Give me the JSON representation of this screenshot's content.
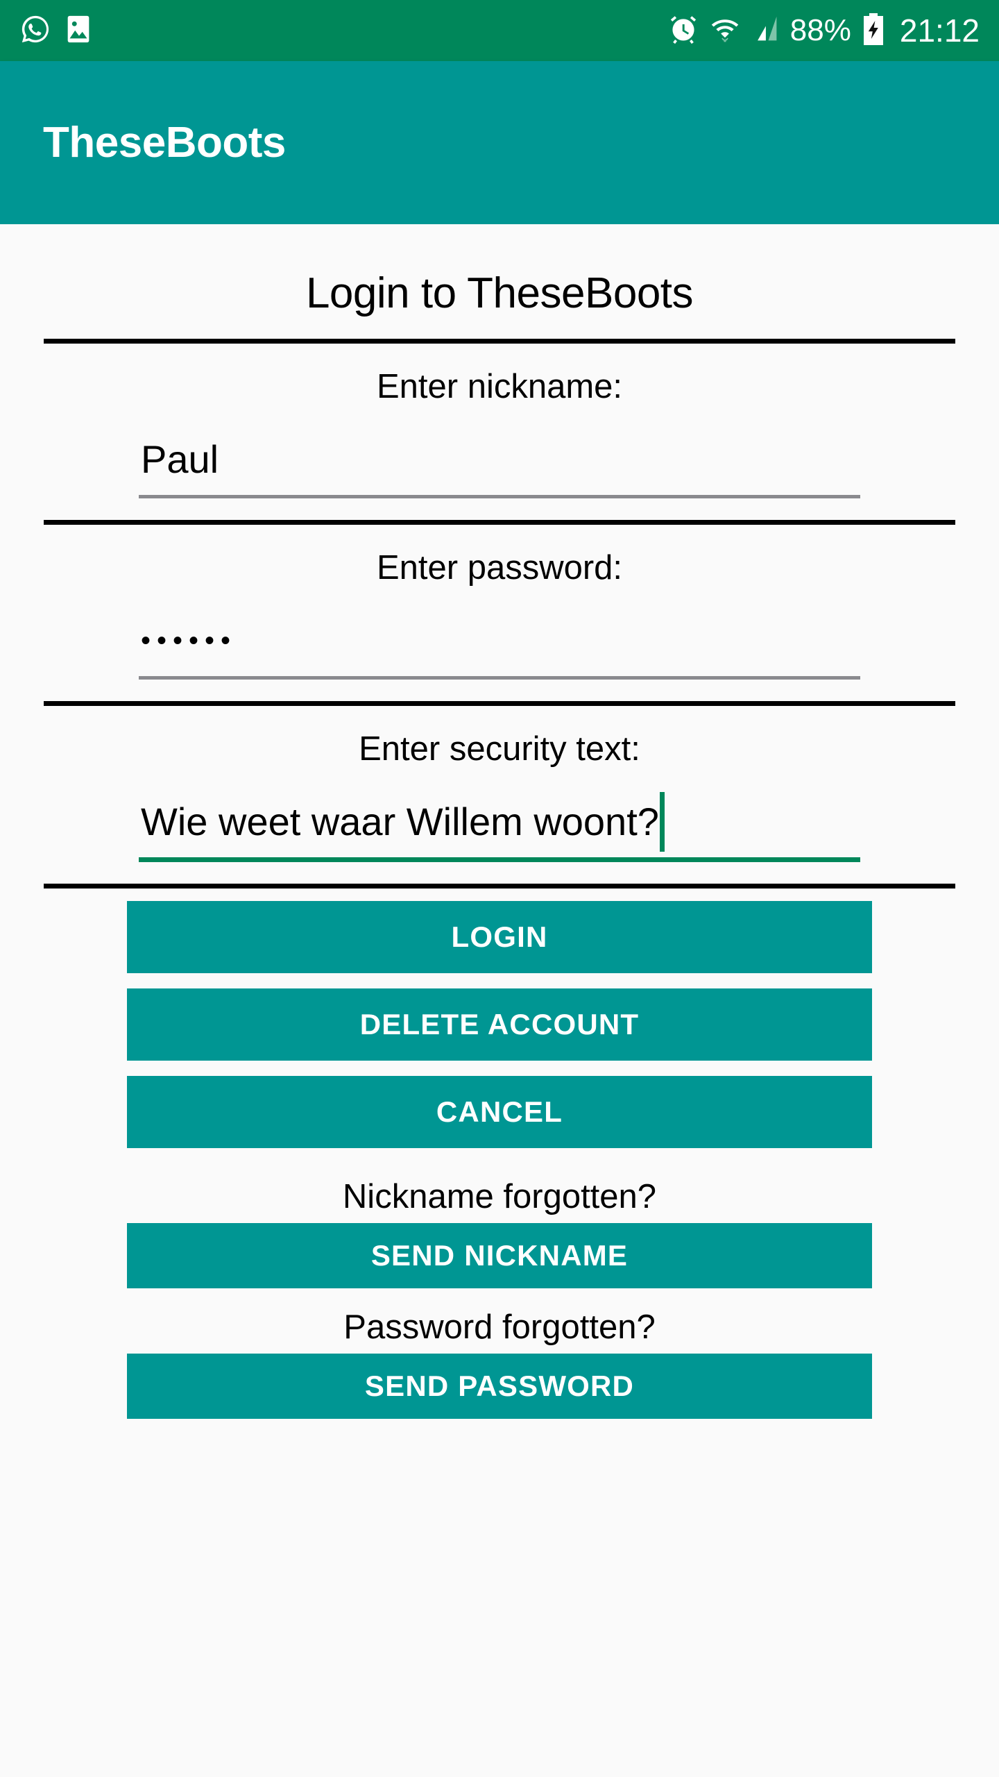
{
  "statusbar": {
    "left_icons": [
      "whatsapp-icon",
      "photo-icon"
    ],
    "right_icons": [
      "alarm-icon",
      "wifi-icon",
      "signal-icon",
      "battery-charging-icon"
    ],
    "battery_percent": "88%",
    "clock": "21:12",
    "background_color": "#00875a"
  },
  "appbar": {
    "title": "TheseBoots",
    "background_color": "#009693"
  },
  "main": {
    "heading": "Login to TheseBoots",
    "fields": [
      {
        "label": "Enter nickname:",
        "value": "Paul",
        "type": "text",
        "focused": false
      },
      {
        "label": "Enter password:",
        "value": "••••••",
        "type": "password",
        "focused": false
      },
      {
        "label": "Enter security text:",
        "value": "Wie weet waar Willem woont?",
        "type": "text",
        "focused": true
      }
    ],
    "buttons": [
      {
        "label": "LOGIN"
      },
      {
        "label": "DELETE ACCOUNT"
      },
      {
        "label": "CANCEL"
      }
    ],
    "recovery": [
      {
        "prompt": "Nickname forgotten?",
        "button": "SEND NICKNAME"
      },
      {
        "prompt": "Password forgotten?",
        "button": "SEND PASSWORD"
      }
    ],
    "accent_color": "#009693",
    "focus_color": "#00875a",
    "divider_color": "#000000"
  }
}
